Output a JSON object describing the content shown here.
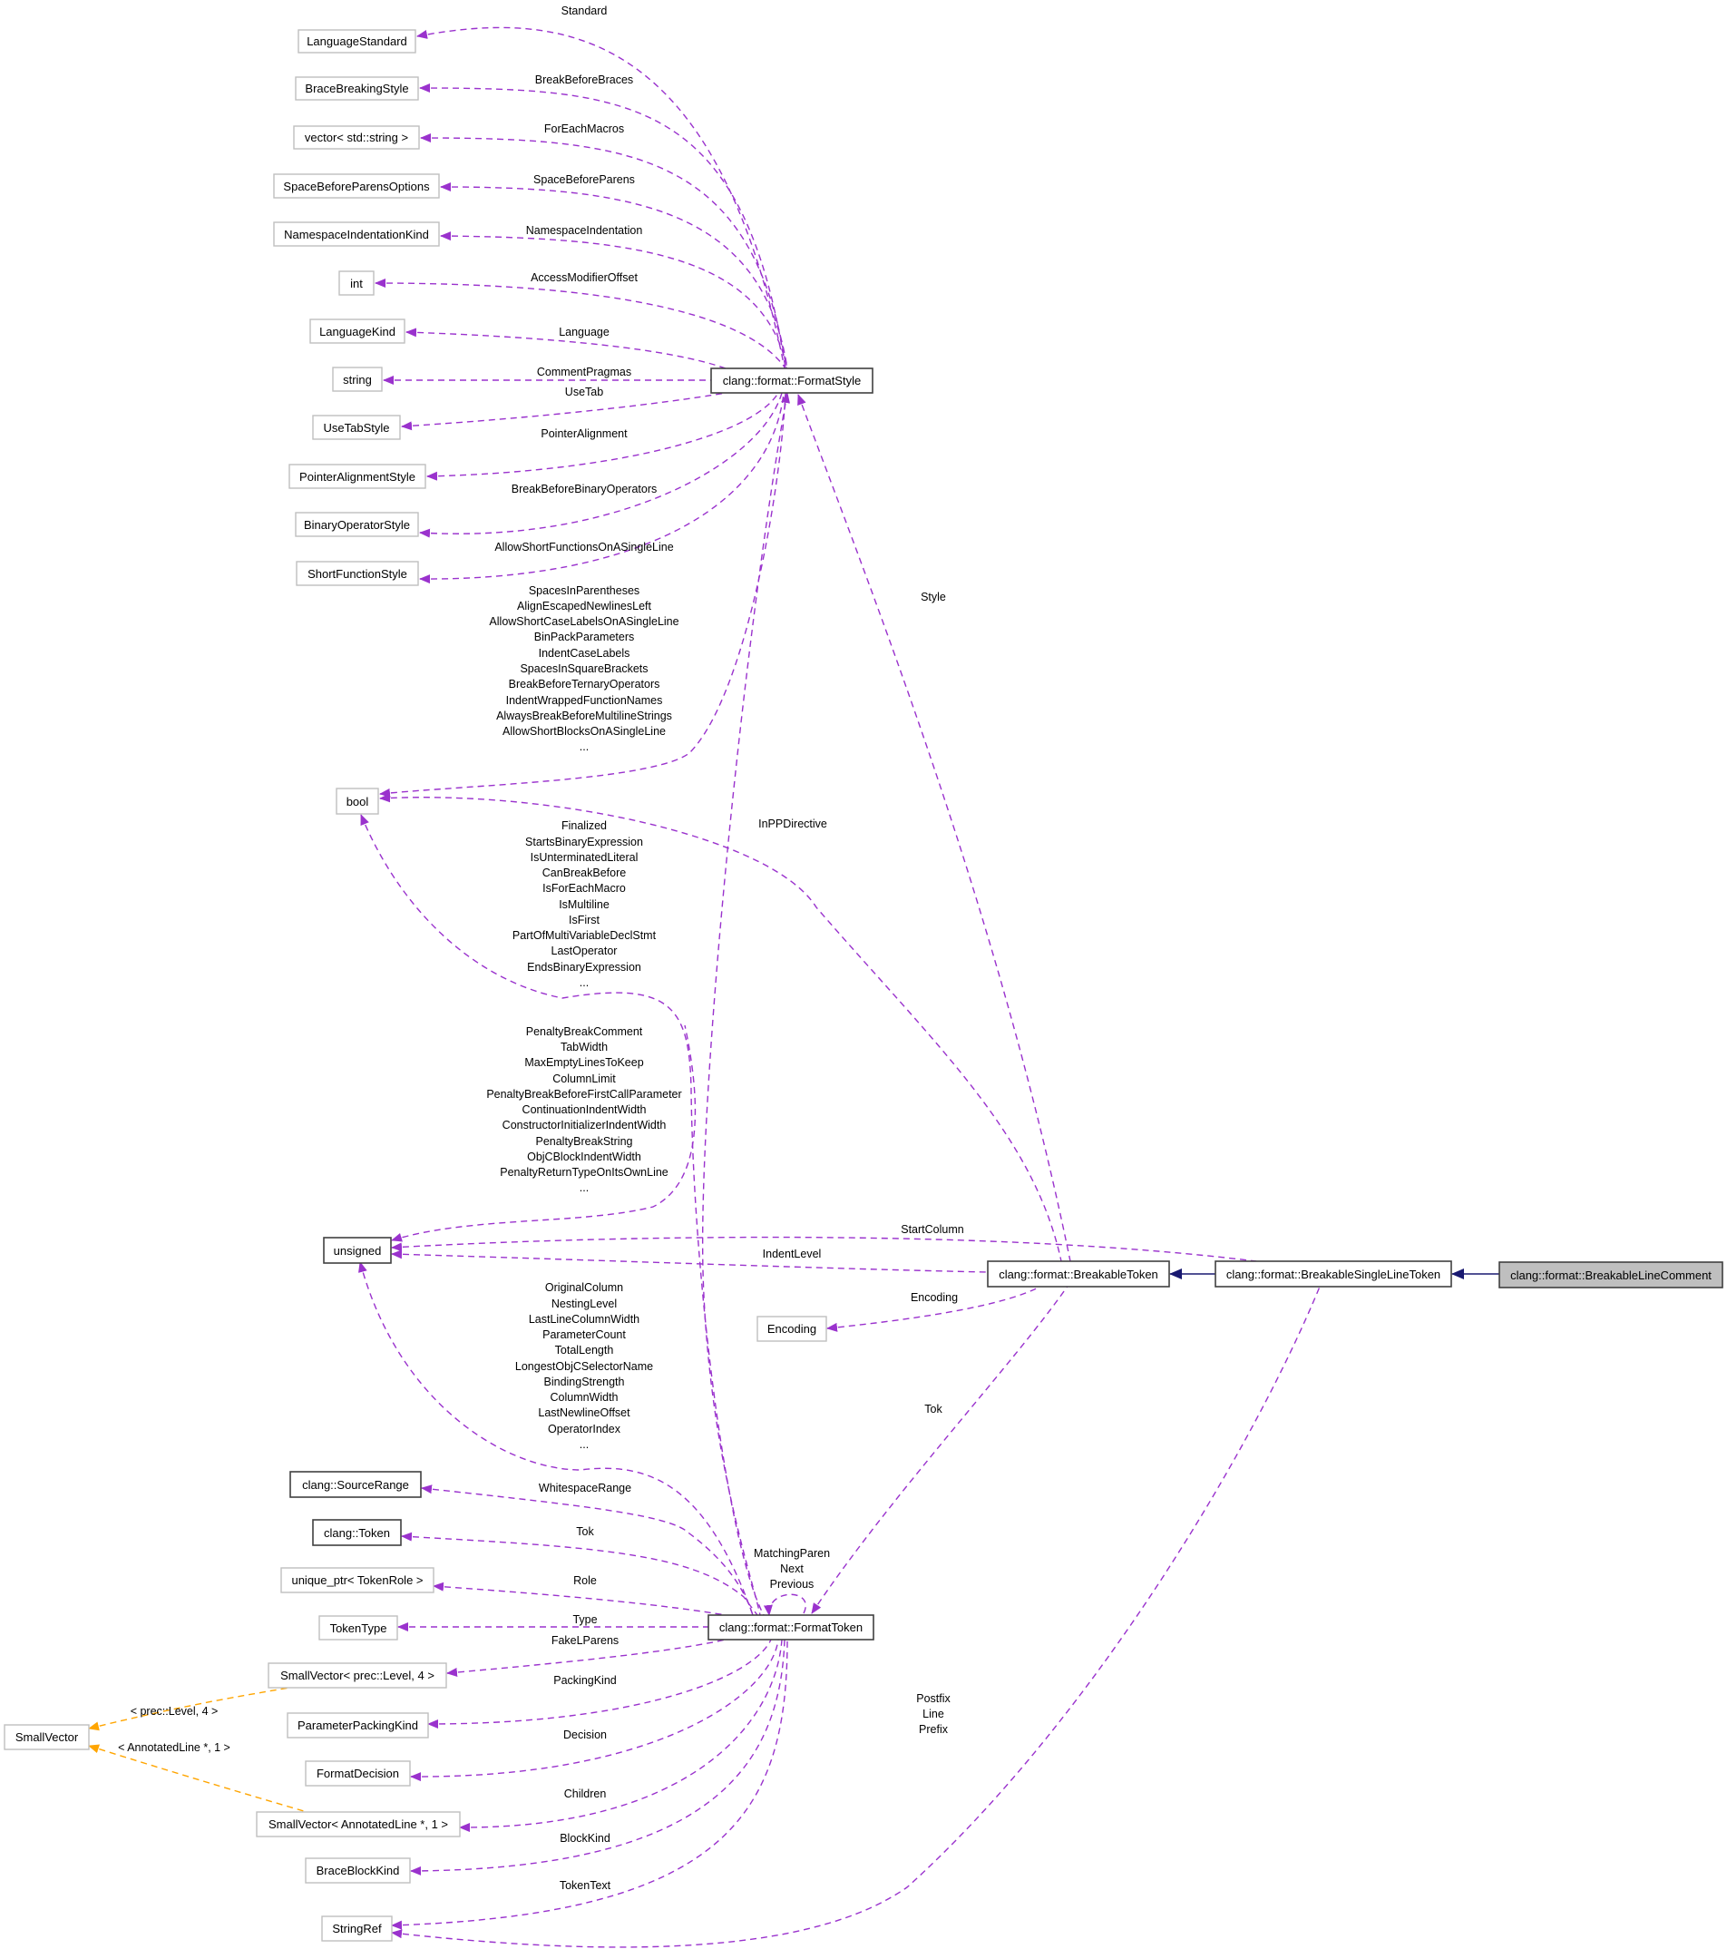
{
  "colors": {
    "member_edge": "#9a32cd",
    "inherit_edge": "#191970",
    "template_edge": "#ffa500",
    "focus_fill": "#bfbfbf",
    "node_border_doc": "#404040",
    "node_border_undoc": "#bfbfbf"
  },
  "nodes": {
    "language_standard": "LanguageStandard",
    "brace_breaking_style": "BraceBreakingStyle",
    "vector_string": "vector< std::string >",
    "space_before_parens_options": "SpaceBeforeParensOptions",
    "namespace_indentation_kind": "NamespaceIndentationKind",
    "int": "int",
    "language_kind": "LanguageKind",
    "string": "string",
    "use_tab_style": "UseTabStyle",
    "pointer_alignment_style": "PointerAlignmentStyle",
    "binary_operator_style": "BinaryOperatorStyle",
    "short_function_style": "ShortFunctionStyle",
    "bool": "bool",
    "unsigned": "unsigned",
    "encoding": "Encoding",
    "source_range": "clang::SourceRange",
    "clang_token": "clang::Token",
    "unique_ptr_token_role": "unique_ptr< TokenRole >",
    "token_type": "TokenType",
    "small_vector_prec": "SmallVector< prec::Level, 4 >",
    "parameter_packing_kind": "ParameterPackingKind",
    "format_decision": "FormatDecision",
    "small_vector_annotated": "SmallVector< AnnotatedLine *, 1 >",
    "brace_block_kind": "BraceBlockKind",
    "string_ref": "StringRef",
    "small_vector": "SmallVector",
    "format_style": "clang::format::FormatStyle",
    "format_token": "clang::format::FormatToken",
    "breakable_token": "clang::format::BreakableToken",
    "breakable_single_line_token": "clang::format::BreakableSingleLineToken",
    "breakable_line_comment": "clang::format::BreakableLineComment"
  },
  "edges": {
    "standard": [
      "Standard"
    ],
    "break_before_braces": [
      "BreakBeforeBraces"
    ],
    "for_each_macros": [
      "ForEachMacros"
    ],
    "space_before_parens": [
      "SpaceBeforeParens"
    ],
    "namespace_indentation": [
      "NamespaceIndentation"
    ],
    "access_modifier_offset": [
      "AccessModifierOffset"
    ],
    "language": [
      "Language"
    ],
    "comment_pragmas": [
      "CommentPragmas"
    ],
    "use_tab": [
      "UseTab"
    ],
    "pointer_alignment": [
      "PointerAlignment"
    ],
    "break_before_binary_operators": [
      "BreakBeforeBinaryOperators"
    ],
    "allow_short_functions": [
      "AllowShortFunctionsOnASingleLine"
    ],
    "style_bools": [
      "SpacesInParentheses",
      "AlignEscapedNewlinesLeft",
      "AllowShortCaseLabelsOnASingleLine",
      "BinPackParameters",
      "IndentCaseLabels",
      "SpacesInSquareBrackets",
      "BreakBeforeTernaryOperators",
      "IndentWrappedFunctionNames",
      "AlwaysBreakBeforeMultilineStrings",
      "AllowShortBlocksOnASingleLine",
      "..."
    ],
    "token_bools": [
      "Finalized",
      "StartsBinaryExpression",
      "IsUnterminatedLiteral",
      "CanBreakBefore",
      "IsForEachMacro",
      "IsMultiline",
      "IsFirst",
      "PartOfMultiVariableDeclStmt",
      "LastOperator",
      "EndsBinaryExpression",
      "..."
    ],
    "style_unsigned": [
      "PenaltyBreakComment",
      "TabWidth",
      "MaxEmptyLinesToKeep",
      "ColumnLimit",
      "PenaltyBreakBeforeFirstCallParameter",
      "ContinuationIndentWidth",
      "ConstructorInitializerIndentWidth",
      "PenaltyBreakString",
      "ObjCBlockIndentWidth",
      "PenaltyReturnTypeOnItsOwnLine",
      "..."
    ],
    "token_unsigned": [
      "OriginalColumn",
      "NestingLevel",
      "LastLineColumnWidth",
      "ParameterCount",
      "TotalLength",
      "LongestObjCSelectorName",
      "BindingStrength",
      "ColumnWidth",
      "LastNewlineOffset",
      "OperatorIndex",
      "..."
    ],
    "style": [
      "Style"
    ],
    "in_pp_directive": [
      "InPPDirective"
    ],
    "start_column": [
      "StartColumn"
    ],
    "indent_level": [
      "IndentLevel"
    ],
    "encoding": [
      "Encoding"
    ],
    "tok_breakable": [
      "Tok"
    ],
    "whitespace_range": [
      "WhitespaceRange"
    ],
    "tok_clang": [
      "Tok"
    ],
    "self_links": [
      "MatchingParen",
      "Next",
      "Previous"
    ],
    "role": [
      "Role"
    ],
    "type": [
      "Type"
    ],
    "fake_lparens": [
      "FakeLParens"
    ],
    "packing_kind": [
      "PackingKind"
    ],
    "decision": [
      "Decision"
    ],
    "children": [
      "Children"
    ],
    "block_kind": [
      "BlockKind"
    ],
    "token_text": [
      "TokenText"
    ],
    "postfix_line_prefix": [
      "Postfix",
      "Line",
      "Prefix"
    ],
    "tmpl_prec": [
      "< prec::Level, 4 >"
    ],
    "tmpl_annotated": [
      "< AnnotatedLine *, 1 >"
    ]
  }
}
